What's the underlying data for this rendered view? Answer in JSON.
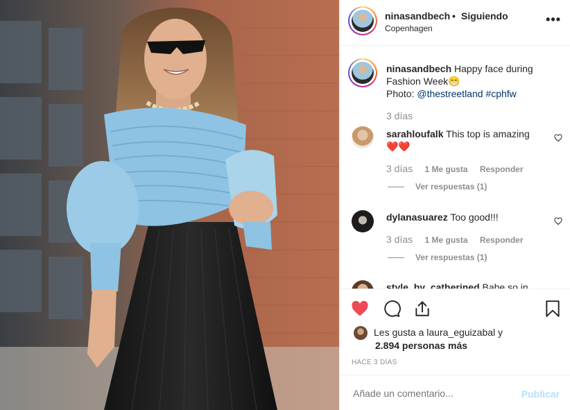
{
  "post": {
    "username": "ninasandbech",
    "separator": "•",
    "follow_status": "Siguiendo",
    "location": "Copenhagen",
    "more_icon": "more-options-icon"
  },
  "caption": {
    "username": "ninasandbech",
    "text_part1": "Happy face during",
    "text_part2": "Fashion Week",
    "emoji": "😁",
    "photo_label": "Photo:",
    "mention": "@thestreetland",
    "hashtag": "#cphfw",
    "time": "3 días"
  },
  "comments": [
    {
      "username": "sarahloufalk",
      "text": "This top is amazing",
      "emoji": "❤️❤️",
      "time": "3 días",
      "likes": "1 Me gusta",
      "reply": "Responder",
      "view_replies": "Ver respuestas (1)"
    },
    {
      "username": "dylanasuarez",
      "text": "Too good!!!",
      "time": "3 días",
      "likes": "1 Me gusta",
      "reply": "Responder",
      "view_replies": "Ver respuestas (1)"
    },
    {
      "username": "style_by_catherined",
      "text": "Babe so in"
    }
  ],
  "actions": {
    "like_icon": "heart-filled-icon",
    "comment_icon": "comment-icon",
    "share_icon": "share-icon",
    "save_icon": "bookmark-icon",
    "liked_color": "#ed4956"
  },
  "likes": {
    "line1": "Les gusta a laura_eguizabal y",
    "line2": "2.894 personas más"
  },
  "posted_ago": "HACE 3 DÍAS",
  "add_comment": {
    "placeholder": "Añade un comentario...",
    "post_label": "Publicar",
    "post_color": "#b2dffc"
  }
}
